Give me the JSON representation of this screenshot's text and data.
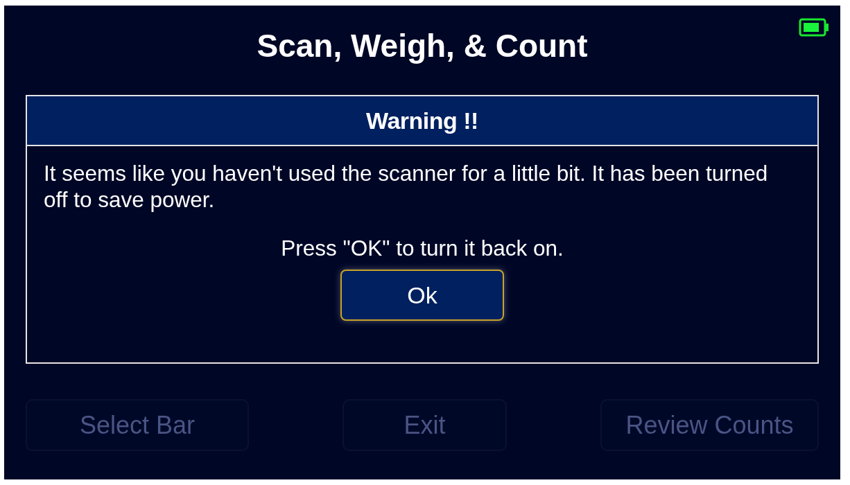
{
  "header": {
    "title": "Scan, Weigh, & Count"
  },
  "dialog": {
    "title": "Warning !!",
    "message": "It seems like you haven't used the scanner for a little bit. It has been turned off to save power.",
    "instruction": "Press \"OK\" to turn it back on.",
    "button": "Ok"
  },
  "buttons": [
    {
      "label": "Select Bar",
      "disabled": true
    },
    {
      "label": "Exit",
      "disabled": true
    },
    {
      "label": "Review Counts",
      "disabled": true
    }
  ]
}
